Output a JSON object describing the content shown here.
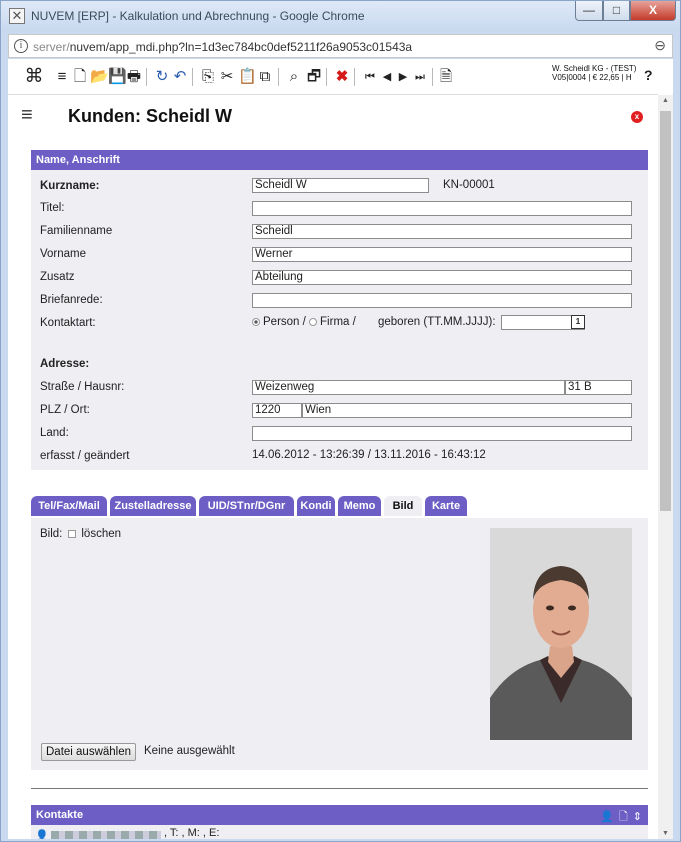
{
  "window": {
    "title": "NUVEM [ERP] - Kalkulation und Abrechnung - Google Chrome",
    "min_label": "—",
    "max_label": "□",
    "close_label": "X"
  },
  "address": {
    "host": "server/",
    "path": "nuvem/app_mdi.php?ln=1d3ec784bc0def5211f26a9053c01543a"
  },
  "toolbar": {
    "status_line1": "W. Scheidl KG - (TEST)",
    "status_line2": "V05|0004 | € 22,65 | H",
    "help": "?"
  },
  "header": {
    "page_title": "Kunden: Scheidl W",
    "close_label": "x"
  },
  "name_section": {
    "title": "Name, Anschrift",
    "kurzname_label": "Kurzname:",
    "kurzname_value": "Scheidl W",
    "kundennummer": "KN-00001",
    "titel_label": "Titel:",
    "titel_value": "",
    "familienname_label": "Familienname",
    "familienname_value": "Scheidl",
    "vorname_label": "Vorname",
    "vorname_value": "Werner",
    "zusatz_label": "Zusatz",
    "zusatz_value": "Abteilung",
    "briefanrede_label": "Briefanrede:",
    "briefanrede_value": "",
    "kontaktart_label": "Kontaktart:",
    "kontaktart_person": "Person /",
    "kontaktart_firma": "Firma /",
    "geboren_label": "geboren  (TT.MM.JJJJ):",
    "geboren_value": "",
    "calendar_button": "1",
    "adresse_label": "Adresse:",
    "strasse_label": "Straße / Hausnr:",
    "strasse_value": "Weizenweg",
    "hausnr_value": "31 B",
    "plzort_label": "PLZ / Ort:",
    "plz_value": "1220",
    "ort_value": "Wien",
    "land_label": "Land:",
    "land_value": "",
    "erfasst_label": "erfasst / geändert",
    "erfasst_value": "14.06.2012 - 13:26:39  /  13.11.2016 - 16:43:12"
  },
  "tabs": [
    {
      "label": "Tel/Fax/Mail"
    },
    {
      "label": "Zustelladresse"
    },
    {
      "label": "UID/STnr/DGnr"
    },
    {
      "label": "Kondi"
    },
    {
      "label": "Memo"
    },
    {
      "label": "Bild"
    },
    {
      "label": "Karte"
    }
  ],
  "bild": {
    "bild_label": "Bild:",
    "loeschen_label": "löschen",
    "file_button": "Datei auswählen",
    "file_status": "Keine ausgewählt"
  },
  "kontakte": {
    "title": "Kontakte",
    "line": ", T: , M: , E:"
  },
  "colors": {
    "section_header": "#6d5ec5",
    "panel_bg": "#eeeef3",
    "delete_red": "#d51a1a"
  }
}
